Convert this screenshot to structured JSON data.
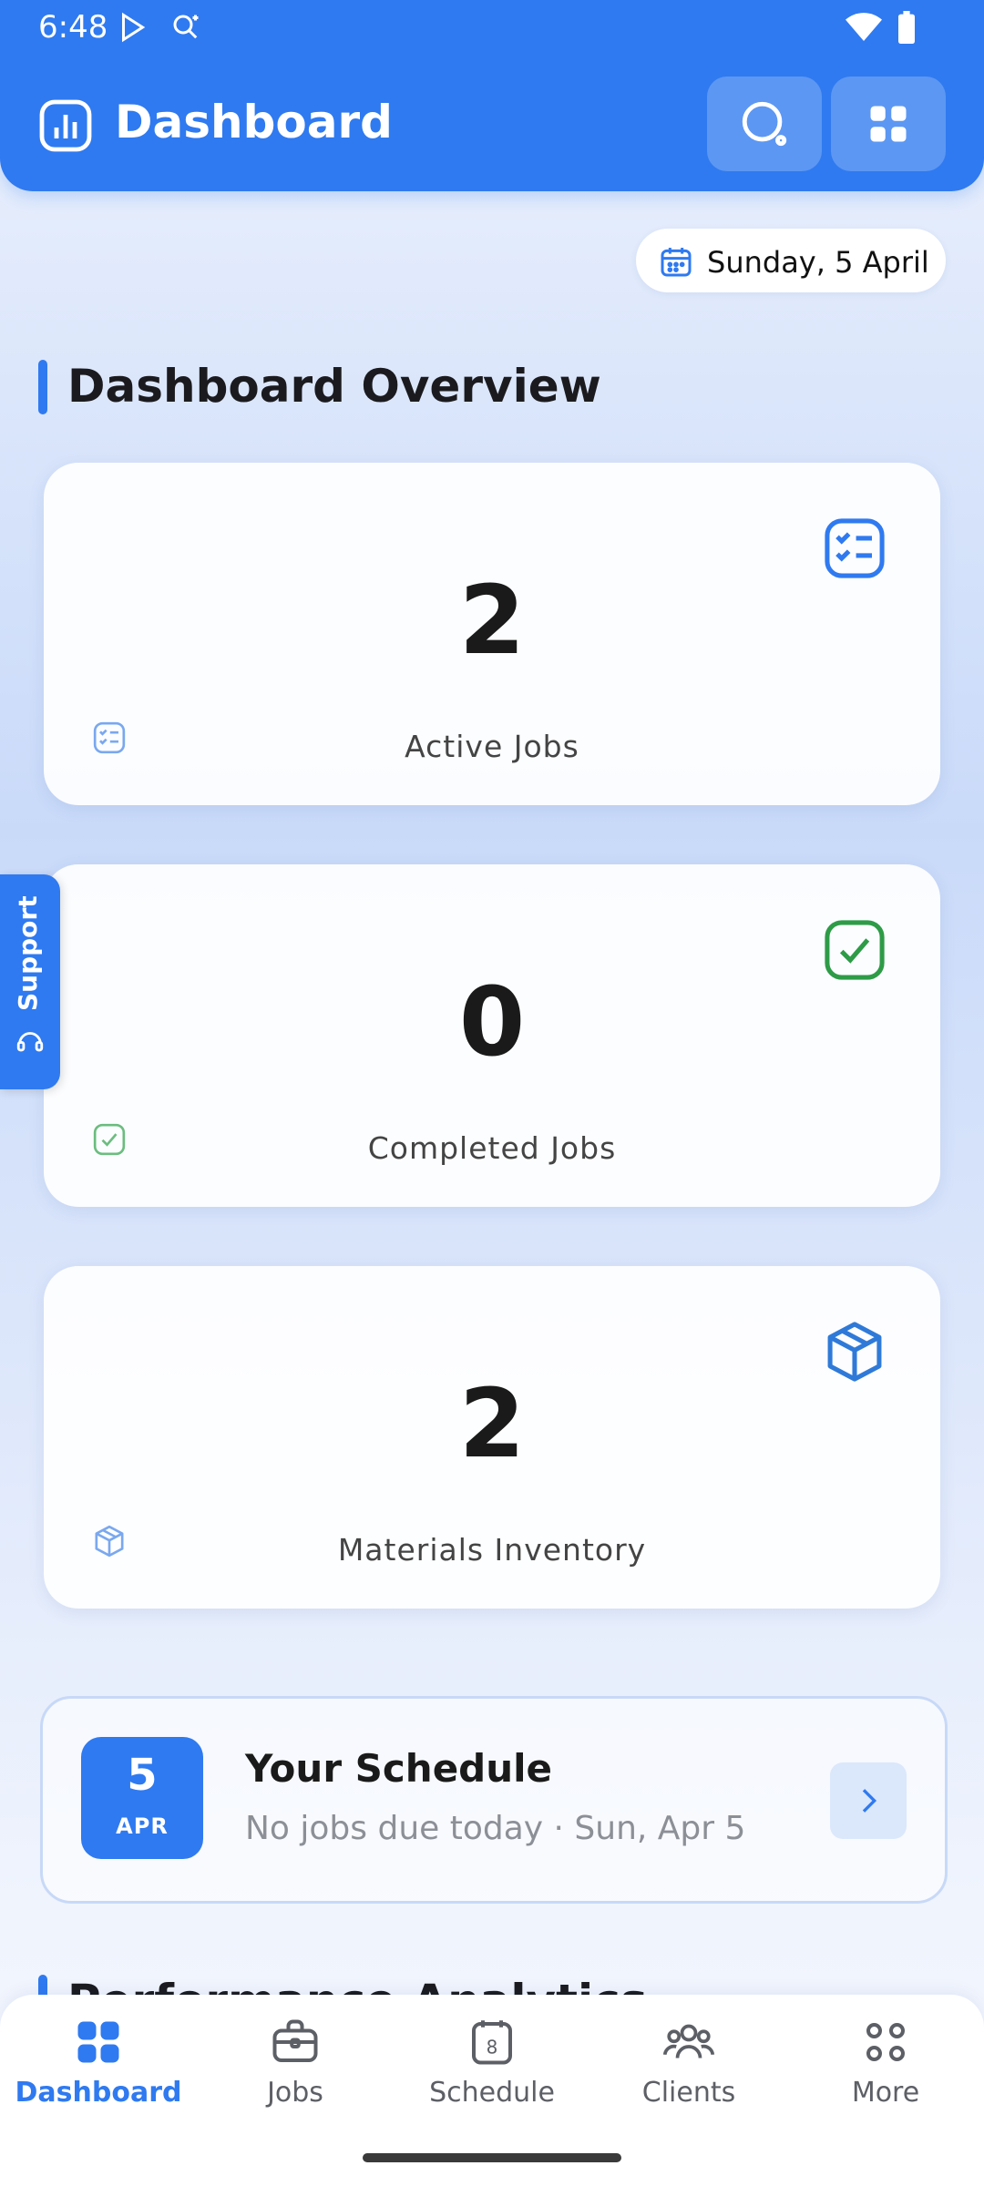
{
  "status_bar": {
    "time": "6:48"
  },
  "header": {
    "title": "Dashboard"
  },
  "date_pill": {
    "text": "Sunday, 5 April"
  },
  "overview": {
    "title": "Dashboard Overview",
    "cards": [
      {
        "value": "2",
        "label": "Active Jobs",
        "icon": "checklist-icon",
        "color": "#2f7af0"
      },
      {
        "value": "0",
        "label": "Completed Jobs",
        "icon": "check-box-icon",
        "color": "#2e9b47"
      },
      {
        "value": "2",
        "label": "Materials Inventory",
        "icon": "box-icon",
        "color": "#2f7ad8"
      }
    ]
  },
  "support": {
    "label": "Support"
  },
  "schedule": {
    "day": "5",
    "month": "APR",
    "title": "Your Schedule",
    "subtitle": "No jobs due today · Sun, Apr 5"
  },
  "next_section": {
    "title": "Performance Analytics"
  },
  "bottom_nav": {
    "items": [
      {
        "label": "Dashboard",
        "icon": "grid-icon",
        "active": true
      },
      {
        "label": "Jobs",
        "icon": "briefcase-icon",
        "active": false
      },
      {
        "label": "Schedule",
        "icon": "calendar-icon",
        "active": false,
        "badge": "8"
      },
      {
        "label": "Clients",
        "icon": "people-icon",
        "active": false
      },
      {
        "label": "More",
        "icon": "more-dots-icon",
        "active": false
      }
    ]
  },
  "colors": {
    "primary": "#2f7af0",
    "success": "#2e9b47",
    "text": "#1b1b1f"
  }
}
